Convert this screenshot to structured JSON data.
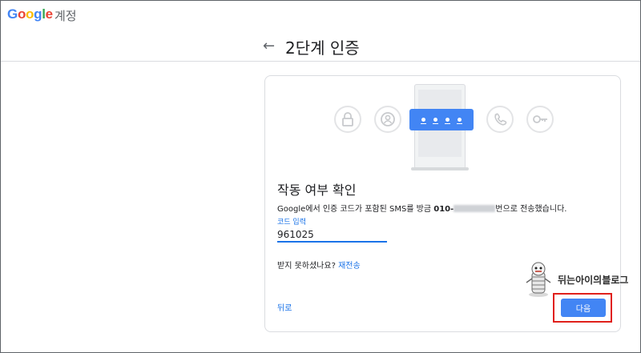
{
  "app": {
    "logo_letters": [
      "G",
      "o",
      "o",
      "g",
      "l",
      "e"
    ],
    "product_name": "계정"
  },
  "header": {
    "back_icon": "arrow-left-icon",
    "title": "2단계 인증"
  },
  "illustration": {
    "icons": [
      "lock-icon",
      "person-icon",
      "phone-call-icon",
      "key-icon"
    ],
    "password_dots": 4,
    "accent_color": "#4285f4"
  },
  "card": {
    "heading": "작동 여부 확인",
    "description_before": "Google에서 인증 코드가 포함된 SMS를 방금 ",
    "phone_prefix": "010-",
    "description_after": "번으로 전송했습니다.",
    "code_label": "코드 입력",
    "code_value": "961025",
    "resend_prompt": "받지 못하셨나요? ",
    "resend_link": "재전송",
    "back_link": "뒤로",
    "next_button": "다음"
  },
  "watermark": {
    "text": "뒤는아이의블로그"
  },
  "colors": {
    "link": "#1a73e8",
    "button": "#4285f4",
    "highlight_box": "#e0201b"
  }
}
